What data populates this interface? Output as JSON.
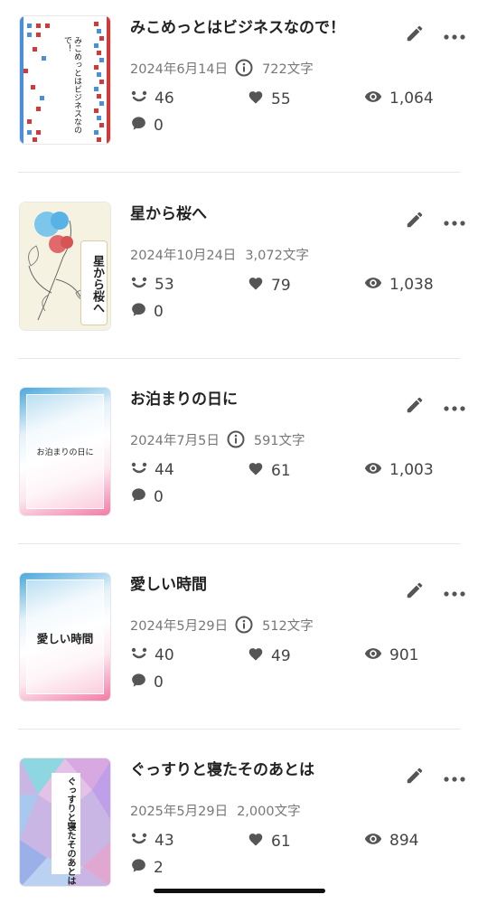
{
  "articles": [
    {
      "title": "みこめっとはビジネスなので！",
      "date": "2024年6月14日",
      "has_info": true,
      "chars": "722文字",
      "likes": "46",
      "hearts": "55",
      "views": "1,064",
      "comments": "0",
      "cover_text": "みこめっとはビジネスなので！",
      "cover_style": "pixel"
    },
    {
      "title": "星から桜へ",
      "date": "2024年10月24日",
      "has_info": false,
      "chars": "3,072文字",
      "likes": "53",
      "hearts": "79",
      "views": "1,038",
      "comments": "0",
      "cover_text": "星から桜へ",
      "cover_style": "flower"
    },
    {
      "title": "お泊まりの日に",
      "date": "2024年7月5日",
      "has_info": true,
      "chars": "591文字",
      "likes": "44",
      "hearts": "61",
      "views": "1,003",
      "comments": "0",
      "cover_text": "お泊まりの日に",
      "cover_style": "gradient"
    },
    {
      "title": "愛しい時間",
      "date": "2024年5月29日",
      "has_info": true,
      "chars": "512文字",
      "likes": "40",
      "hearts": "49",
      "views": "901",
      "comments": "0",
      "cover_text": "愛しい時間",
      "cover_style": "gradient"
    },
    {
      "title": "ぐっすりと寝たそのあとは",
      "date": "2025年5月29日",
      "has_info": false,
      "chars": "2,000文字",
      "likes": "43",
      "hearts": "61",
      "views": "894",
      "comments": "2",
      "cover_text": "ぐっすりと寝たそのあとは",
      "cover_style": "prism"
    }
  ],
  "icons": {
    "edit": "pencil-icon",
    "more": "more-horizontal-icon",
    "info": "info-circle-icon",
    "like": "smile-icon",
    "heart": "heart-icon",
    "view": "eye-icon",
    "comment": "comment-bubble-icon"
  },
  "colors": {
    "icon_gray": "#555555",
    "meta_gray": "#777777",
    "pixel_red": "#d23a3a",
    "pixel_blue": "#4a90d9",
    "gradient_blue": "#4aa8dc",
    "gradient_pink": "#f27ba6"
  }
}
